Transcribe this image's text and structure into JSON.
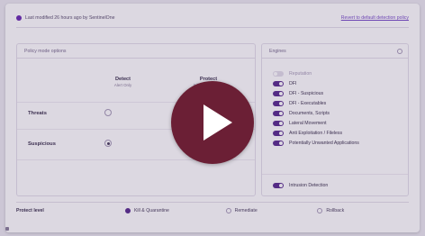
{
  "header": {
    "last_modified": "Last modified 26 hours ago by SentinelOne",
    "reset_link": "Revert to default detection policy"
  },
  "policy": {
    "title": "Policy mode options",
    "columns": [
      {
        "title": "Detect",
        "subtitle": "Alert Only"
      },
      {
        "title": "Protect",
        "subtitle": "Kill & Quarantine"
      }
    ],
    "rows": [
      {
        "label": "Threats",
        "selected": "detect"
      },
      {
        "label": "Suspicious",
        "selected": "detect"
      }
    ]
  },
  "engines": {
    "title": "Engines",
    "items": [
      {
        "label": "Reputation",
        "enabled": false
      },
      {
        "label": "DFI",
        "enabled": true
      },
      {
        "label": "DFI - Suspicious",
        "enabled": true
      },
      {
        "label": "DFI - Executables",
        "enabled": true
      },
      {
        "label": "Documents, Scripts",
        "enabled": true
      },
      {
        "label": "Lateral Movement",
        "enabled": true
      },
      {
        "label": "Anti Exploitation / Fileless",
        "enabled": true
      },
      {
        "label": "Potentially Unwanted Applications",
        "enabled": true
      }
    ],
    "intrusion": {
      "label": "Intrusion Detection",
      "enabled": true
    }
  },
  "protection": {
    "label": "Protect level",
    "options": [
      {
        "label": "Kill & Quarantine",
        "selected": true
      },
      {
        "label": "Remediate",
        "selected": false
      },
      {
        "label": "Rollback",
        "selected": false
      }
    ]
  },
  "video": {
    "play_icon": "play-icon",
    "accent": "#6b1f35"
  }
}
